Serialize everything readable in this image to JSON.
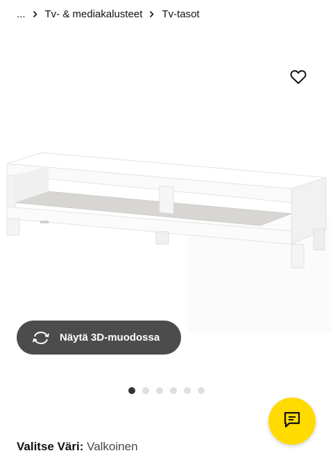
{
  "breadcrumb": {
    "ellipsis": "...",
    "items": [
      "Tv- & mediakalusteet",
      "Tv-tasot"
    ]
  },
  "icons": {
    "favorite": "heart-icon",
    "rotate": "rotate-3d-icon",
    "chat": "chat-icon",
    "separator": "chevron-right-icon"
  },
  "view3d": {
    "label": "Näytä 3D-muodossa"
  },
  "carousel": {
    "total": 6,
    "active_index": 0
  },
  "color": {
    "label": "Valitse Väri:",
    "value": "Valkoinen"
  },
  "colors": {
    "button_bg": "#4c4c4c",
    "chat_bg": "#ffdb00",
    "dot_active": "#333333",
    "dot_inactive": "#dfdfdf"
  }
}
